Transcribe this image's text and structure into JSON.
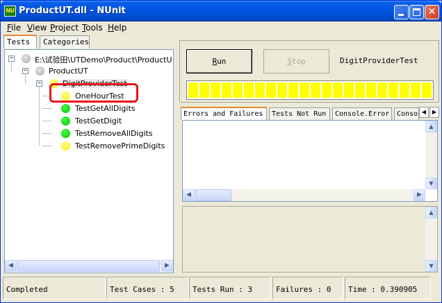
{
  "window": {
    "title": "ProductUT.dll - NUnit",
    "app_icon_text": "NU"
  },
  "menu": [
    {
      "label_first": "F",
      "label_rest": "ile"
    },
    {
      "label_first": "V",
      "label_rest": "iew"
    },
    {
      "label_first": "P",
      "label_rest": "roject"
    },
    {
      "label_first": "T",
      "label_rest": "ools"
    },
    {
      "label_first": "H",
      "label_rest": "elp"
    }
  ],
  "left_tabs": [
    "Tests",
    "Categories"
  ],
  "tree": {
    "root": "E:\\试验田\\UTDemo\\Product\\ProductU",
    "assembly": "ProductUT",
    "fixture": "DigitProviderTest",
    "tests": [
      {
        "name": "OneHourTest",
        "status": "yellow"
      },
      {
        "name": "TestGetAllDigits",
        "status": "green"
      },
      {
        "name": "TestGetDigit",
        "status": "green"
      },
      {
        "name": "TestRemoveAllDigits",
        "status": "green"
      },
      {
        "name": "TestRemovePrimeDigits",
        "status": "yellow"
      }
    ],
    "highlighted_test": "OneHourTest"
  },
  "controls": {
    "run_first": "R",
    "run_rest": "un",
    "stop_first": "S",
    "stop_rest": "top",
    "current_test": "DigitProviderTest",
    "progress_fraction": 1.0,
    "progress_color": "#ffff00"
  },
  "result_tabs": [
    "Errors and Failures",
    "Tests Not Run",
    "Console.Error",
    "Conso"
  ],
  "status": {
    "state": "Completed",
    "test_cases": "Test Cases : 5",
    "tests_run": "Tests Run : 3",
    "failures": "Failures : 0",
    "time": "Time : 0.390905"
  },
  "colors": {
    "titlebar": "#0054e3",
    "highlight_box": "#e8141a",
    "pass": "#00c000",
    "ignored": "#f4ee00",
    "not_run": "#a9a9a9"
  }
}
